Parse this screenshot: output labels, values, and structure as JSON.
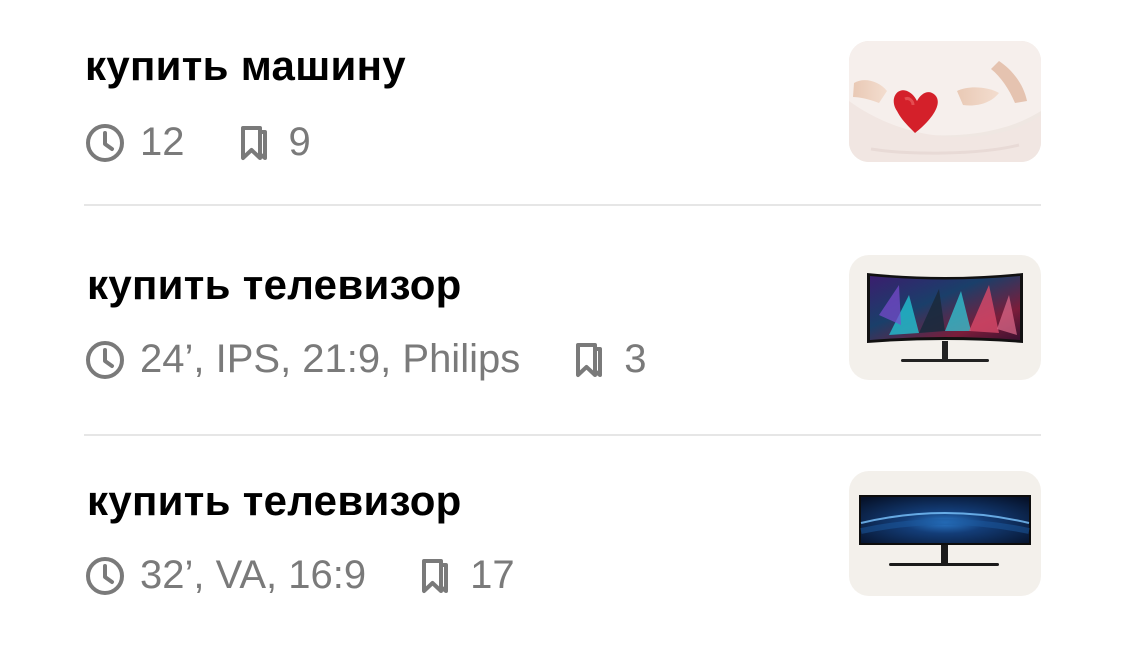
{
  "items": [
    {
      "title": "купить машину",
      "detail": "12",
      "saves": "9",
      "thumbnail": "belly-heart-photo"
    },
    {
      "title": "купить телевизор",
      "detail": "24’, IPS, 21:9, Philips",
      "saves": "3",
      "thumbnail": "curved-monitor-colorful"
    },
    {
      "title": "купить телевизор",
      "detail": "32’, VA, 16:9",
      "saves": "17",
      "thumbnail": "ultrawide-monitor-blue"
    }
  ],
  "icons": {
    "time": "clock-icon",
    "saves": "bookmark-icon"
  },
  "colors": {
    "title": "#000000",
    "meta": "#7a7a7a",
    "divider": "#e6e6e6",
    "thumb_bg": "#f3f0eb"
  }
}
